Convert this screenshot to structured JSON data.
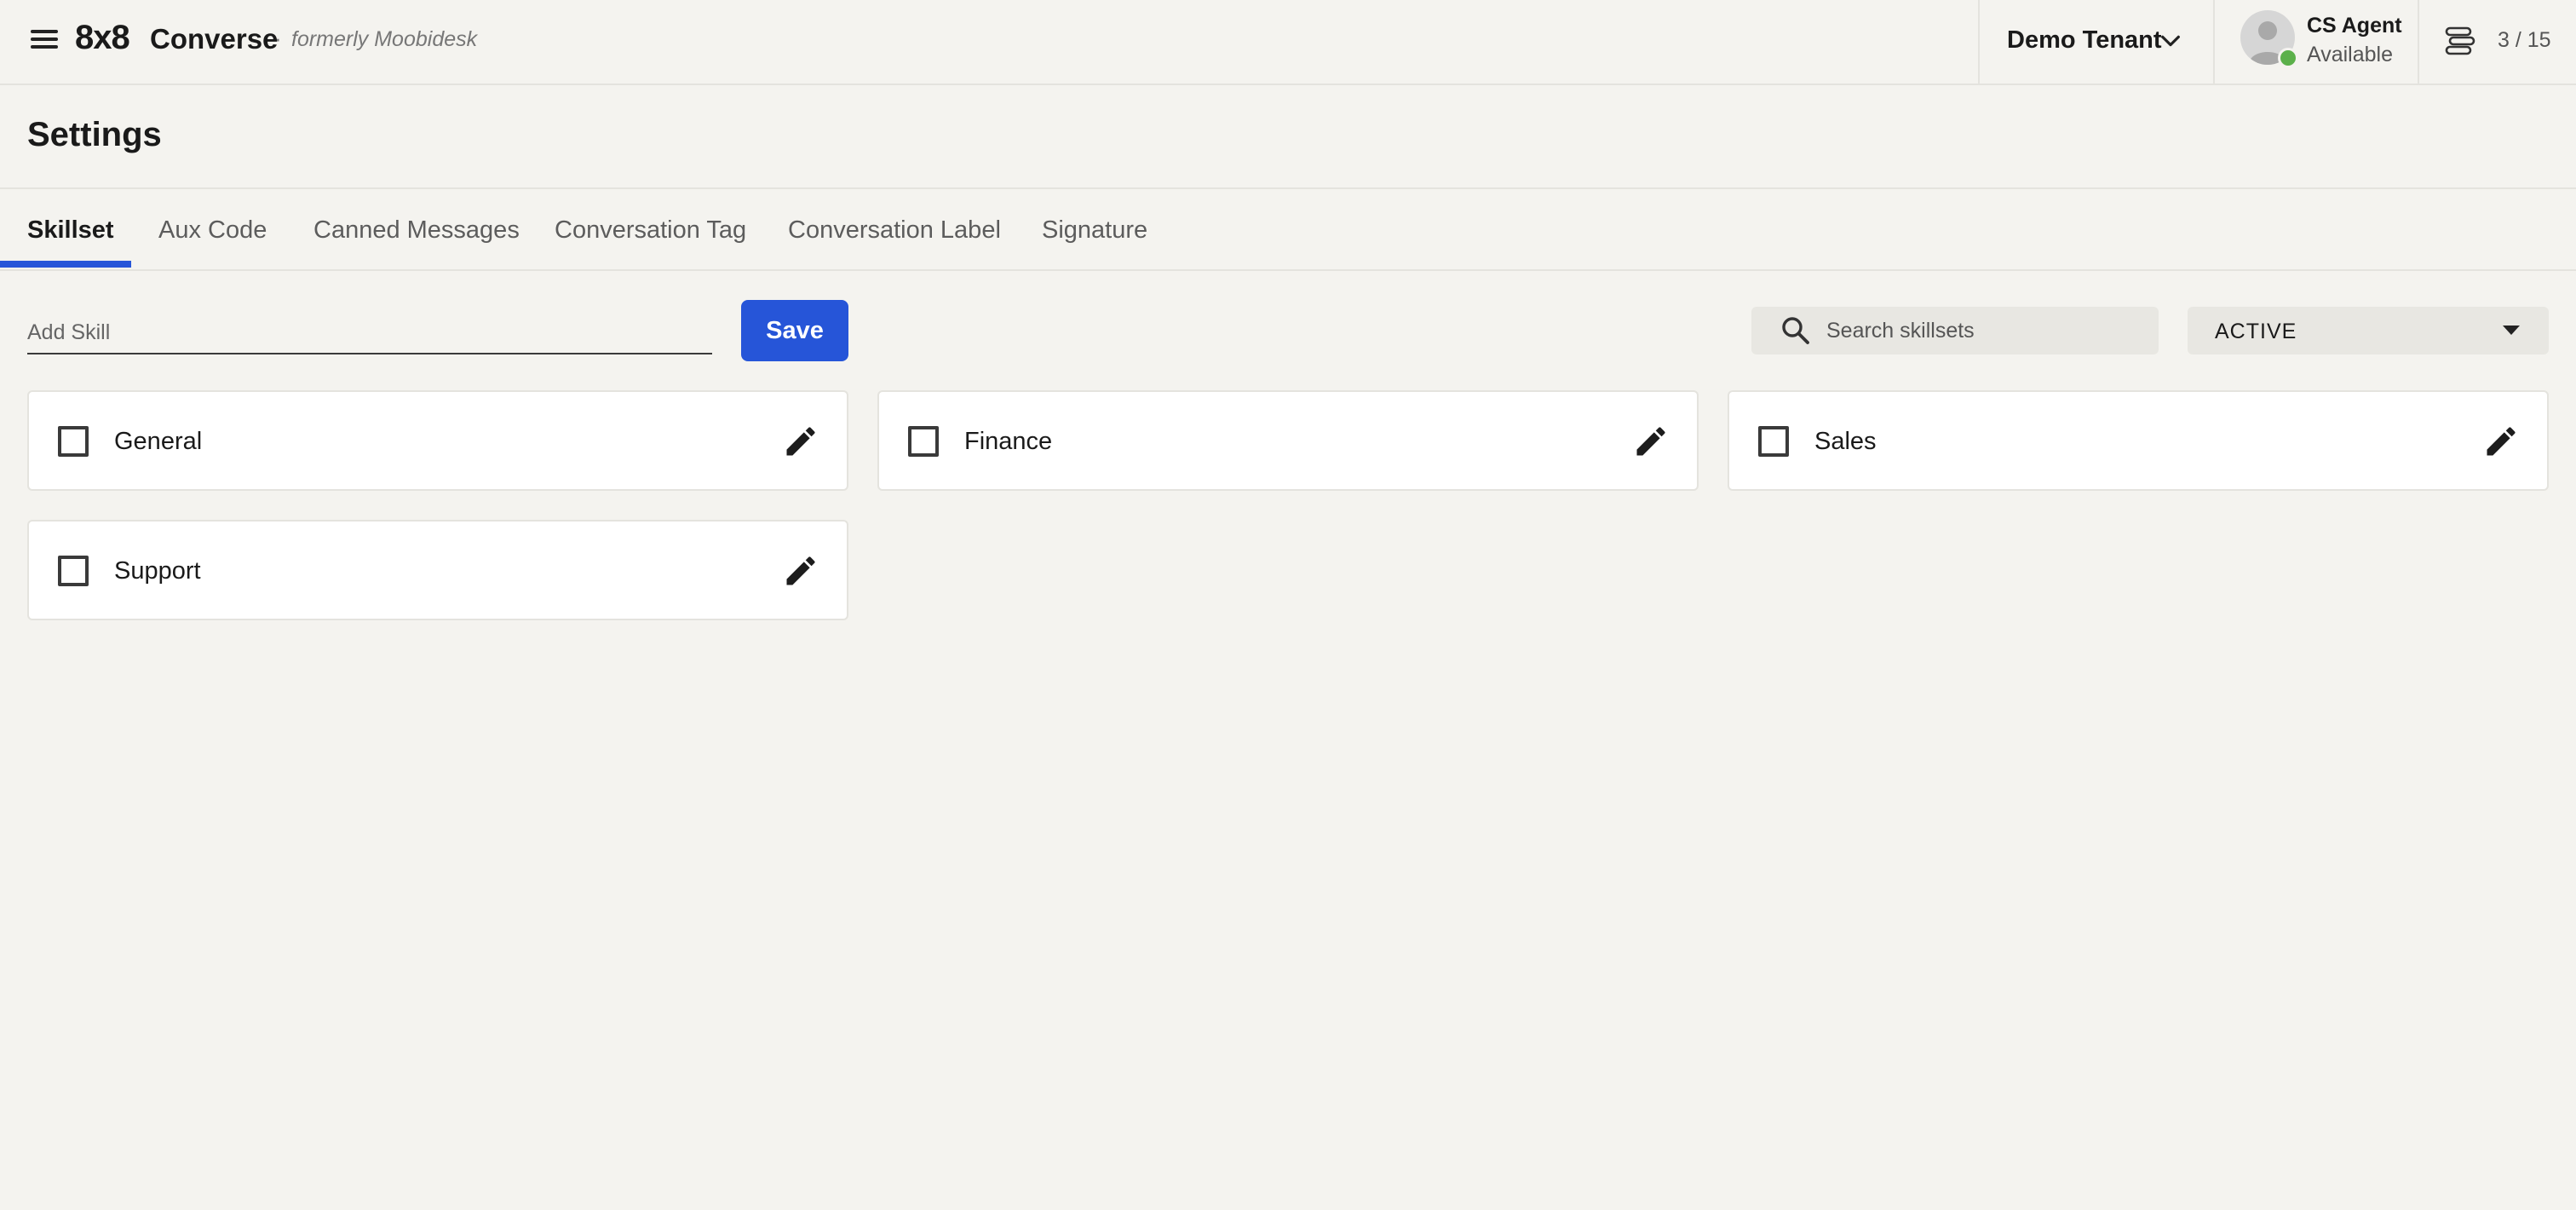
{
  "header": {
    "brand_logo": "8x8",
    "brand_name": "Converse",
    "brand_separator": "·",
    "brand_sub": "formerly Moobidesk",
    "tenant_name": "Demo Tenant",
    "agent_name": "CS Agent",
    "agent_status": "Available",
    "queue_count": "3 / 15",
    "icons": [
      "menu-icon",
      "chevron-down-icon",
      "avatar-icon",
      "queue-icon"
    ],
    "status_color": "#5bb04a"
  },
  "page": {
    "title": "Settings"
  },
  "tabs": [
    {
      "label": "Skillset",
      "active": true
    },
    {
      "label": "Aux Code",
      "active": false
    },
    {
      "label": "Canned Messages",
      "active": false
    },
    {
      "label": "Conversation Tag",
      "active": false
    },
    {
      "label": "Conversation Label",
      "active": false
    },
    {
      "label": "Signature",
      "active": false
    }
  ],
  "toolbar": {
    "add_skill_placeholder": "Add Skill",
    "add_skill_value": "",
    "save_label": "Save",
    "search_placeholder": "Search skillsets",
    "search_value": "",
    "status_filter_value": "ACTIVE"
  },
  "skills": [
    {
      "name": "General",
      "checked": false
    },
    {
      "name": "Finance",
      "checked": false
    },
    {
      "name": "Sales",
      "checked": false
    },
    {
      "name": "Support",
      "checked": false
    }
  ],
  "colors": {
    "accent": "#2655d8",
    "background": "#f4f3ef",
    "card": "#ffffff"
  }
}
